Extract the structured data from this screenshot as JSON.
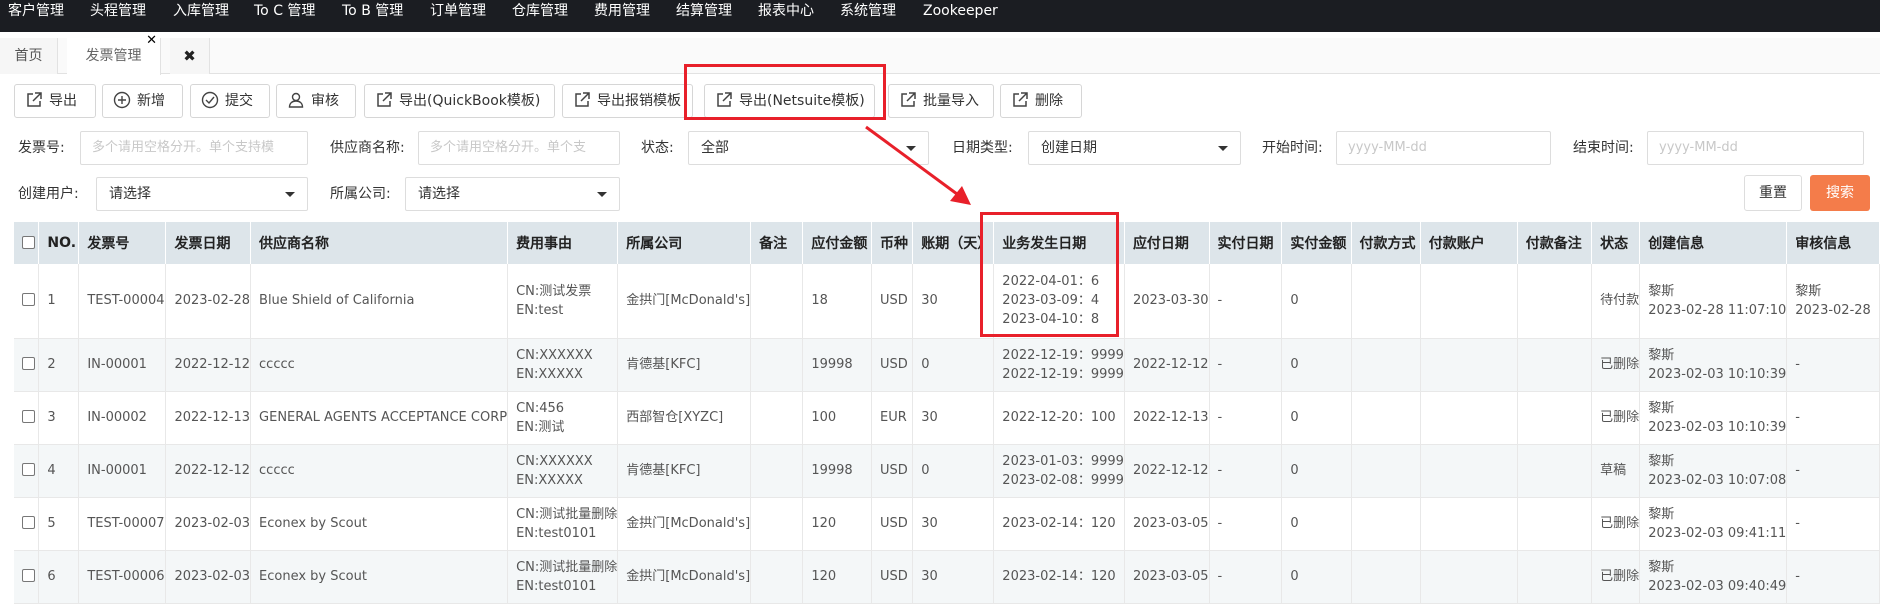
{
  "topnav": [
    "客户管理",
    "头程管理",
    "入库管理",
    "To C 管理",
    "To B 管理",
    "订单管理",
    "仓库管理",
    "费用管理",
    "结算管理",
    "报表中心",
    "系统管理",
    "Zookeeper"
  ],
  "tabs": {
    "home": "首页",
    "invoice": "发票管理",
    "close_tab": "✕",
    "close_all": "✖"
  },
  "toolbar": [
    "导出",
    "新增",
    "提交",
    "审核",
    "导出(QuickBook模板)",
    "导出报销模板",
    "导出(Netsuite模板)",
    "批量导入",
    "删除"
  ],
  "filters": {
    "invoice_no_label": "发票号:",
    "invoice_no_placeholder": "多个请用空格分开。单个支持模",
    "supplier_label": "供应商名称:",
    "supplier_placeholder": "多个请用空格分开。单个支",
    "status_label": "状态:",
    "status_value": "全部",
    "date_type_label": "日期类型:",
    "date_type_value": "创建日期",
    "start_label": "开始时间:",
    "start_placeholder": "yyyy-MM-dd",
    "end_label": "结束时间:",
    "end_placeholder": "yyyy-MM-dd",
    "creator_label": "创建用户:",
    "creator_value": "请选择",
    "company_label": "所属公司:",
    "company_value": "请选择",
    "reset": "重置",
    "search": "搜索"
  },
  "table": {
    "headers": [
      "",
      "NO.",
      "发票号",
      "发票日期",
      "供应商名称",
      "费用事由",
      "所属公司",
      "备注",
      "应付金额",
      "币种",
      "账期（天）",
      "业务发生日期",
      "应付日期",
      "实付日期",
      "实付金额",
      "付款方式",
      "付款账户",
      "付款备注",
      "状态",
      "创建信息",
      "审核信息"
    ],
    "rows": [
      [
        "",
        "1",
        "TEST-00004",
        "2023-02-28",
        "Blue Shield of California",
        [
          "CN:测试发票",
          "EN:test"
        ],
        "金拱门[McDonald's]",
        "",
        "18",
        "USD",
        "30",
        [
          "2022-04-01：6",
          "2023-03-09：4",
          "2023-04-10：8"
        ],
        "2023-03-30",
        "-",
        "0",
        "",
        "",
        "",
        "待付款",
        [
          "黎斯",
          "2023-02-28 11:07:10"
        ],
        [
          "黎斯",
          "2023-02-28"
        ]
      ],
      [
        "",
        "2",
        "IN-00001",
        "2022-12-12",
        "ccccc",
        [
          "CN:XXXXXX",
          "EN:XXXXX"
        ],
        "肯德基[KFC]",
        "",
        "19998",
        "USD",
        "0",
        [
          "2022-12-19：9999",
          "2022-12-19：9999"
        ],
        "2022-12-12",
        "-",
        "0",
        "",
        "",
        "",
        "已删除",
        [
          "黎斯",
          "2023-02-03 10:10:39"
        ],
        "-"
      ],
      [
        "",
        "3",
        "IN-00002",
        "2022-12-13",
        "GENERAL AGENTS ACCEPTANCE CORP",
        [
          "CN:456",
          "EN:测试"
        ],
        "西部智仓[XYZC]",
        "",
        "100",
        "EUR",
        "30",
        [
          "2022-12-20：100"
        ],
        "2022-12-13",
        "-",
        "0",
        "",
        "",
        "",
        "已删除",
        [
          "黎斯",
          "2023-02-03 10:10:39"
        ],
        "-"
      ],
      [
        "",
        "4",
        "IN-00001",
        "2022-12-12",
        "ccccc",
        [
          "CN:XXXXXX",
          "EN:XXXXX"
        ],
        "肯德基[KFC]",
        "",
        "19998",
        "USD",
        "0",
        [
          "2023-01-03：9999",
          "2023-02-08：9999"
        ],
        "2022-12-12",
        "-",
        "0",
        "",
        "",
        "",
        "草稿",
        [
          "黎斯",
          "2023-02-03 10:07:08"
        ],
        "-"
      ],
      [
        "",
        "5",
        "TEST-00007",
        "2023-02-03",
        "Econex by Scout",
        [
          "CN:测试批量删除",
          "EN:test0101"
        ],
        "金拱门[McDonald's]",
        "",
        "120",
        "USD",
        "30",
        [
          "2023-02-14：120"
        ],
        "2023-03-05",
        "-",
        "0",
        "",
        "",
        "",
        "已删除",
        [
          "黎斯",
          "2023-02-03 09:41:11"
        ],
        "-"
      ],
      [
        "",
        "6",
        "TEST-00006",
        "2023-02-03",
        "Econex by Scout",
        [
          "CN:测试批量删除",
          "EN:test0101"
        ],
        "金拱门[McDonald's]",
        "",
        "120",
        "USD",
        "30",
        [
          "2023-02-14：120"
        ],
        "2023-03-05",
        "-",
        "0",
        "",
        "",
        "",
        "已删除",
        [
          "黎斯",
          "2023-02-03 09:40:49"
        ],
        "-"
      ]
    ]
  },
  "colors": {
    "nav_bg": "#1b1d22",
    "header_bg": "#dde5ea",
    "search_btn": "#f47c4a",
    "highlight": "#e8202a"
  }
}
